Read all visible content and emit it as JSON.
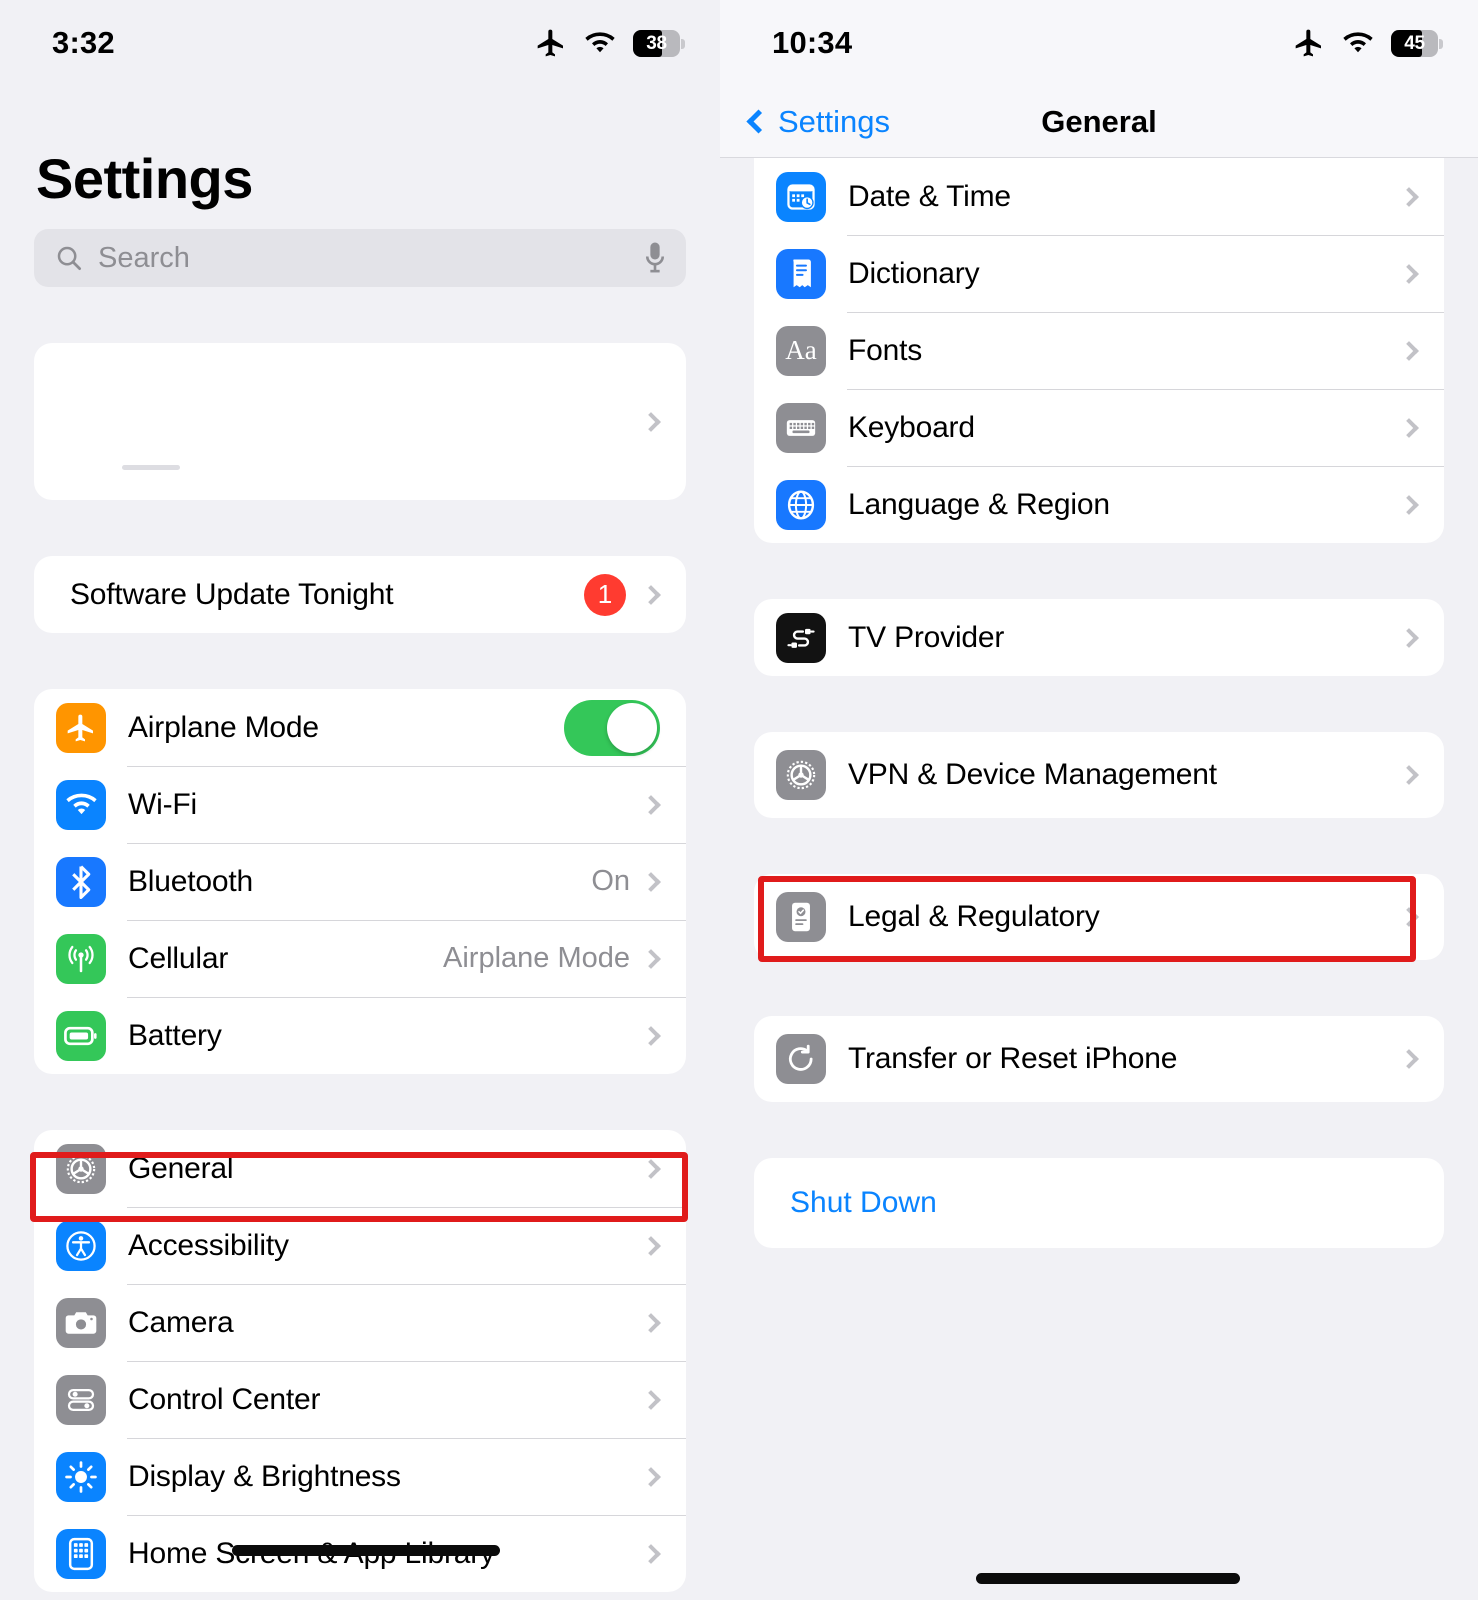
{
  "left": {
    "status": {
      "time": "3:32",
      "airplane_icon": "airplane-icon",
      "wifi_icon": "wifi-icon",
      "battery_percent": "38"
    },
    "title": "Settings",
    "search": {
      "placeholder": "Search",
      "search_icon": "search-icon",
      "mic_icon": "microphone-icon"
    },
    "account_card": {
      "label": "",
      "icon": "apple-id-avatar"
    },
    "update_group": [
      {
        "label": "Software Update Tonight",
        "badge": "1",
        "icon": "none"
      }
    ],
    "connectivity_group": [
      {
        "label": "Airplane Mode",
        "icon": "airplane-icon",
        "icon_color": "#ff9500",
        "control": "toggle",
        "toggle_on": true
      },
      {
        "label": "Wi-Fi",
        "icon": "wifi-icon",
        "icon_color": "#0a84ff",
        "value": ""
      },
      {
        "label": "Bluetooth",
        "icon": "bluetooth-icon",
        "icon_color": "#1878ff",
        "value": "On"
      },
      {
        "label": "Cellular",
        "icon": "cellular-icon",
        "icon_color": "#34c759",
        "value": "Airplane Mode"
      },
      {
        "label": "Battery",
        "icon": "battery-icon",
        "icon_color": "#34c759",
        "value": ""
      }
    ],
    "system_group": [
      {
        "label": "General",
        "icon": "gear-icon",
        "icon_color": "#8e8e93",
        "highlighted": true
      },
      {
        "label": "Accessibility",
        "icon": "accessibility-icon",
        "icon_color": "#0a84ff"
      },
      {
        "label": "Camera",
        "icon": "camera-icon",
        "icon_color": "#8e8e93"
      },
      {
        "label": "Control Center",
        "icon": "control-center-icon",
        "icon_color": "#8e8e93"
      },
      {
        "label": "Display & Brightness",
        "icon": "brightness-icon",
        "icon_color": "#0a84ff"
      },
      {
        "label": "Home Screen & App Library",
        "icon": "home-screen-icon",
        "icon_color": "#0a84ff"
      }
    ],
    "highlight": {
      "target": "General",
      "color": "#e01b1b"
    }
  },
  "right": {
    "status": {
      "time": "10:34",
      "airplane_icon": "airplane-icon",
      "wifi_icon": "wifi-icon",
      "battery_percent": "45"
    },
    "nav": {
      "back_label": "Settings",
      "back_icon": "chevron-left-icon",
      "title": "General"
    },
    "group_a": [
      {
        "label": "Date & Time",
        "icon": "calendar-clock-icon",
        "icon_color": "#0a84ff"
      },
      {
        "label": "Dictionary",
        "icon": "dictionary-icon",
        "icon_color": "#1878ff"
      },
      {
        "label": "Fonts",
        "icon": "fonts-icon",
        "icon_color": "#8e8e93",
        "glyph": "Aa"
      },
      {
        "label": "Keyboard",
        "icon": "keyboard-icon",
        "icon_color": "#8e8e93"
      },
      {
        "label": "Language & Region",
        "icon": "globe-icon",
        "icon_color": "#1878ff"
      }
    ],
    "group_b": [
      {
        "label": "TV Provider",
        "icon": "tv-provider-icon",
        "icon_color": "#121212"
      }
    ],
    "group_c": [
      {
        "label": "VPN & Device Management",
        "icon": "gear-icon",
        "icon_color": "#8e8e93",
        "highlighted": true
      }
    ],
    "group_d": [
      {
        "label": "Legal & Regulatory",
        "icon": "legal-icon",
        "icon_color": "#8e8e93"
      }
    ],
    "group_e": [
      {
        "label": "Transfer or Reset iPhone",
        "icon": "reset-icon",
        "icon_color": "#8e8e93"
      }
    ],
    "group_f": [
      {
        "label": "Shut Down",
        "link_color": "#0a84ff"
      }
    ],
    "highlight": {
      "target": "VPN & Device Management",
      "color": "#e01b1b"
    }
  }
}
